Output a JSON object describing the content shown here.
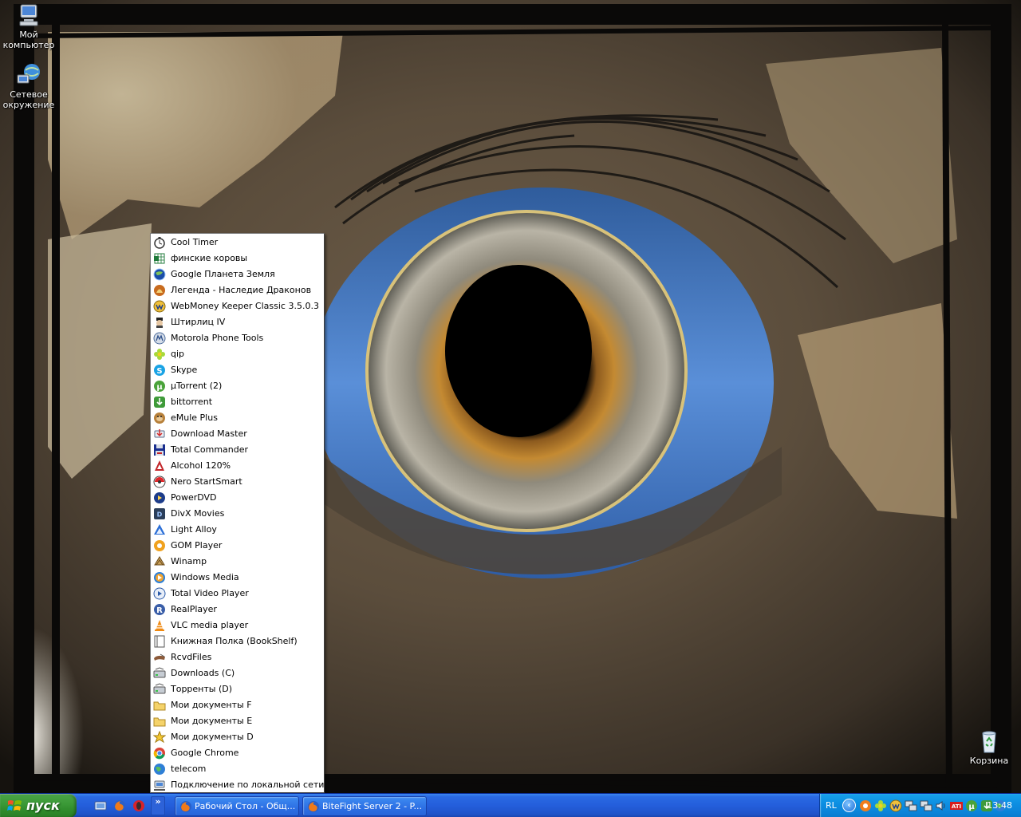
{
  "desktop": {
    "icons": [
      {
        "label": "Мой\nкомпьютер",
        "icon": "my-computer-icon"
      },
      {
        "label": "Сетевое\nокружение",
        "icon": "network-places-icon"
      },
      {
        "label": "Корзина",
        "icon": "recycle-bin-icon"
      }
    ]
  },
  "quick_launch_menu": {
    "items": [
      {
        "label": "Cool Timer",
        "icon": "stopwatch-icon"
      },
      {
        "label": "финские коровы",
        "icon": "spreadsheet-icon"
      },
      {
        "label": "Google Планета Земля",
        "icon": "google-earth-icon"
      },
      {
        "label": "Легенда - Наследие Драконов",
        "icon": "dragon-game-icon"
      },
      {
        "label": "WebMoney Keeper Classic 3.5.0.3",
        "icon": "webmoney-icon"
      },
      {
        "label": "Штирлиц IV",
        "icon": "stirlitz-icon"
      },
      {
        "label": "Motorola Phone Tools",
        "icon": "motorola-icon"
      },
      {
        "label": "qip",
        "icon": "qip-flower-icon"
      },
      {
        "label": "Skype",
        "icon": "skype-icon"
      },
      {
        "label": "µTorrent (2)",
        "icon": "utorrent-icon"
      },
      {
        "label": "bittorrent",
        "icon": "bittorrent-icon"
      },
      {
        "label": "eMule Plus",
        "icon": "emule-icon"
      },
      {
        "label": "Download Master",
        "icon": "download-master-icon"
      },
      {
        "label": "Total Commander",
        "icon": "total-commander-icon"
      },
      {
        "label": "Alcohol 120%",
        "icon": "alcohol-icon"
      },
      {
        "label": "Nero StartSmart",
        "icon": "nero-icon"
      },
      {
        "label": "PowerDVD",
        "icon": "powerdvd-icon"
      },
      {
        "label": "DivX Movies",
        "icon": "divx-icon"
      },
      {
        "label": "Light Alloy",
        "icon": "light-alloy-icon"
      },
      {
        "label": "GOM Player",
        "icon": "gom-player-icon"
      },
      {
        "label": "Winamp",
        "icon": "winamp-icon"
      },
      {
        "label": "Windows Media",
        "icon": "windows-media-icon"
      },
      {
        "label": "Total Video Player",
        "icon": "total-video-player-icon"
      },
      {
        "label": "RealPlayer",
        "icon": "realplayer-icon"
      },
      {
        "label": "VLC media player",
        "icon": "vlc-cone-icon"
      },
      {
        "label": "Книжная Полка (BookShelf)",
        "icon": "bookshelf-icon"
      },
      {
        "label": "RcvdFiles",
        "icon": "received-files-icon"
      },
      {
        "label": "Downloads (C)",
        "icon": "drive-shortcut-icon"
      },
      {
        "label": "Торренты (D)",
        "icon": "drive-shortcut-icon"
      },
      {
        "label": "Мои документы F",
        "icon": "folder-icon"
      },
      {
        "label": "Мои документы E",
        "icon": "folder-icon"
      },
      {
        "label": "Мои документы D",
        "icon": "star-folder-icon"
      },
      {
        "label": "Google Chrome",
        "icon": "chrome-icon"
      },
      {
        "label": "telecom",
        "icon": "globe-icon"
      },
      {
        "label": "Подключение по локальной сети",
        "icon": "network-connection-icon"
      }
    ]
  },
  "taskbar": {
    "start_label": "пуск",
    "chevron": "»",
    "quick_launch": [
      "show-desktop-icon",
      "firefox-icon",
      "opera-icon"
    ],
    "tasks": [
      {
        "label": "Рабочий Стол - Общ...",
        "icon": "firefox-icon"
      },
      {
        "label": "BiteFight Server 2 - P...",
        "icon": "firefox-icon"
      }
    ],
    "tray": {
      "language": "RL",
      "expand": "‹",
      "icons": [
        "avast-icon",
        "qip-flower-icon",
        "webmoney-icon",
        "network-icon",
        "network-icon",
        "speaker-icon",
        "ati-icon",
        "utorrent-icon",
        "bittorrent-icon",
        "globe-icon"
      ],
      "time": "13:48"
    }
  },
  "colors": {
    "taskbar_blue": "#245edb",
    "start_green": "#3c9a38",
    "tray_blue": "#0d8fe2",
    "menu_bg": "#ffffff",
    "menu_highlight": "#316ac5"
  }
}
